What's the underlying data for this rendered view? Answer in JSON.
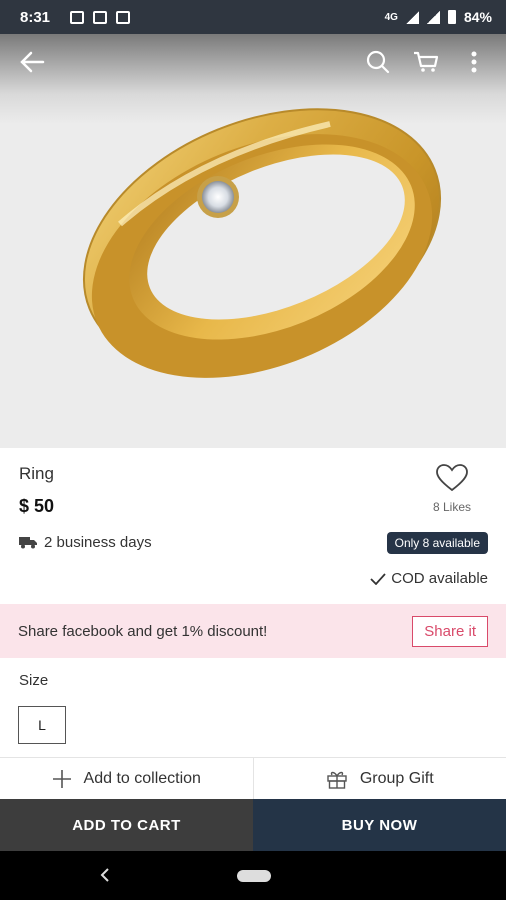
{
  "status_bar": {
    "time": "8:31",
    "network": "4G",
    "battery": "84%"
  },
  "toolbar": {
    "icons": [
      "back-arrow-icon",
      "search-icon",
      "cart-icon",
      "more-vert-icon"
    ]
  },
  "product": {
    "name": "Ring",
    "price": "$ 50",
    "likes": "8 Likes",
    "delivery": "2 business days",
    "stock_badge": "Only 8 available",
    "cod": "COD available"
  },
  "promo": {
    "text": "Share facebook and get 1% discount!",
    "button": "Share it"
  },
  "size": {
    "label": "Size",
    "selected": "L"
  },
  "actions": {
    "collection": "Add to collection",
    "gift": "Group Gift"
  },
  "cta": {
    "cart": "ADD TO CART",
    "buy": "BUY NOW"
  },
  "colors": {
    "buy_now_bg": "#243447",
    "add_cart_bg": "#3d3d3d",
    "promo_bg": "#fbe4ea",
    "share_accent": "#d94a6a",
    "ring_gold": "#d9a93a"
  }
}
